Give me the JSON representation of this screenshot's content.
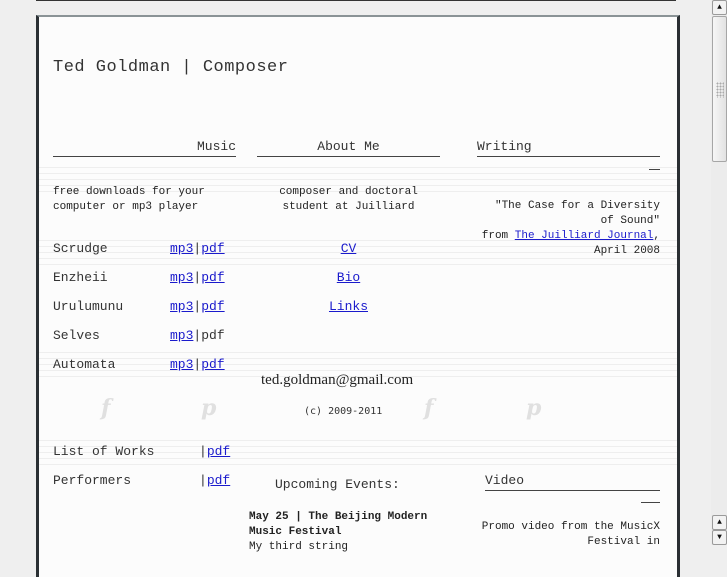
{
  "site_title": "Ted Goldman | Composer",
  "sections": {
    "music": {
      "heading": "Music",
      "description_line1": "free downloads for your",
      "description_line2": "computer or mp3 player",
      "works": [
        {
          "name": "Scrudge",
          "mp3": "mp3",
          "sep": "|",
          "pdf": "pdf",
          "pdf_link": true
        },
        {
          "name": "Enzheii",
          "mp3": "mp3",
          "sep": "|",
          "pdf": "pdf",
          "pdf_link": true
        },
        {
          "name": "Urulumunu",
          "mp3": "mp3",
          "sep": "|",
          "pdf": "pdf",
          "pdf_link": true
        },
        {
          "name": "Selves",
          "mp3": "mp3",
          "sep": "|",
          "pdf": "pdf",
          "pdf_link": false
        },
        {
          "name": "Automata",
          "mp3": "mp3",
          "sep": "|",
          "pdf": "pdf",
          "pdf_link": true
        }
      ],
      "other": [
        {
          "name": "List of Works",
          "sep": "|",
          "pdf": "pdf"
        },
        {
          "name": "Performers",
          "sep": "|",
          "pdf": "pdf"
        }
      ]
    },
    "about": {
      "heading": "About Me",
      "description_line1": "composer and doctoral",
      "description_line2": "student at Juilliard",
      "links": [
        "CV",
        "Bio",
        "Links"
      ]
    },
    "writing": {
      "heading": "Writing",
      "quote_line1": "\"The Case for a Diversity",
      "quote_line2": "of Sound\"",
      "from": "from ",
      "journal_link": "The Juilliard Journal",
      "comma": ",",
      "date": "April 2008"
    },
    "contact": {
      "email": "ted.goldman@gmail.com",
      "copyright": "(c)  2009-2011"
    },
    "events": {
      "heading": "Upcoming Events:",
      "item_title_line1": "May 25 | The Beijing Modern",
      "item_title_line2": "Music Festival",
      "item_desc": "My third string"
    },
    "video": {
      "heading": "Video",
      "desc_line1": "Promo video from the MusicX",
      "desc_line2": "Festival in"
    }
  },
  "scrollbar": {
    "up": "▲",
    "down": "▼",
    "position_fraction": 0.0
  }
}
